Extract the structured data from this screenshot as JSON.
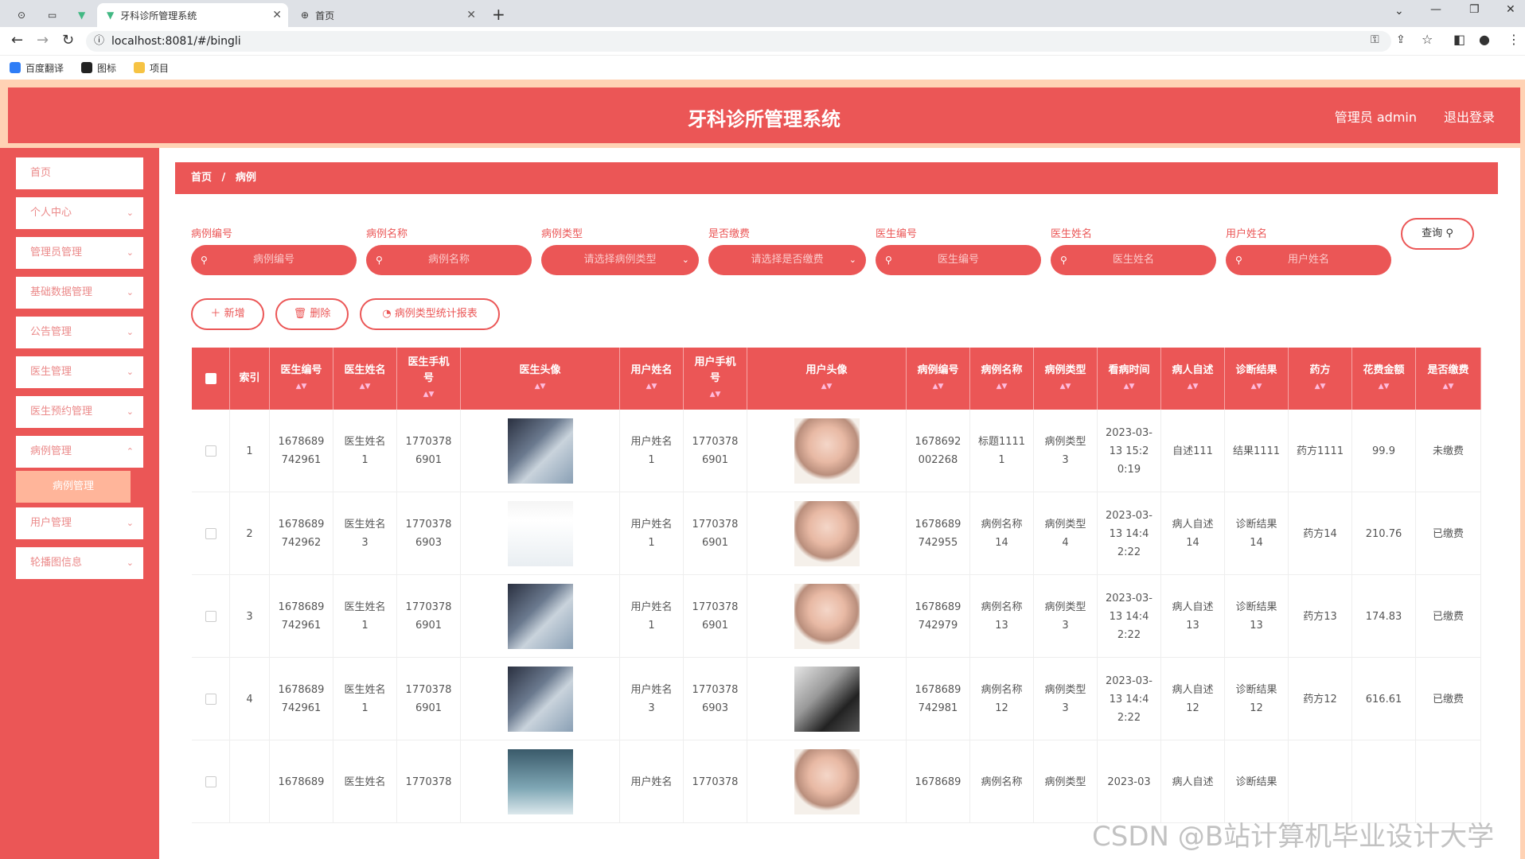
{
  "browser": {
    "tabs": [
      {
        "label": "牙科诊所管理系统"
      },
      {
        "label": "首页"
      }
    ],
    "url": "localhost:8081/#/bingli",
    "bookmarks": [
      "百度翻译",
      "图标",
      "项目"
    ]
  },
  "header": {
    "title": "牙科诊所管理系统",
    "user": "管理员 admin",
    "logout": "退出登录"
  },
  "sidebar": {
    "items": [
      {
        "label": "首页"
      },
      {
        "label": "个人中心"
      },
      {
        "label": "管理员管理"
      },
      {
        "label": "基础数据管理"
      },
      {
        "label": "公告管理"
      },
      {
        "label": "医生管理"
      },
      {
        "label": "医生预约管理"
      },
      {
        "label": "病例管理"
      },
      {
        "label": "用户管理"
      },
      {
        "label": "轮播图信息"
      }
    ],
    "active_sub": "病例管理"
  },
  "breadcrumb": {
    "home": "首页",
    "sep": "/",
    "current": "病例"
  },
  "filters": [
    {
      "label": "病例编号",
      "placeholder": "病例编号"
    },
    {
      "label": "病例名称",
      "placeholder": "病例名称"
    },
    {
      "label": "病例类型",
      "placeholder": "请选择病例类型"
    },
    {
      "label": "是否缴费",
      "placeholder": "请选择是否缴费"
    },
    {
      "label": "医生编号",
      "placeholder": "医生编号"
    },
    {
      "label": "医生姓名",
      "placeholder": "医生姓名"
    },
    {
      "label": "用户姓名",
      "placeholder": "用户姓名"
    }
  ],
  "buttons": {
    "query": "查询",
    "add": "新增",
    "delete": "删除",
    "report": "病例类型统计报表"
  },
  "table": {
    "headers": [
      "索引",
      "医生编号",
      "医生姓名",
      "医生手机号",
      "医生头像",
      "用户姓名",
      "用户手机号",
      "用户头像",
      "病例编号",
      "病例名称",
      "病例类型",
      "看病时间",
      "病人自述",
      "诊断结果",
      "药方",
      "花费金额",
      "是否缴费"
    ],
    "rows": [
      {
        "index": "1",
        "doc_no": "1678689742961",
        "doc_name": "医生姓名1",
        "doc_phone": "17703786901",
        "user_name": "用户姓名1",
        "user_phone": "17703786901",
        "case_no": "1678692002268",
        "case_name": "标题11111",
        "case_type": "病例类型3",
        "time": "2023-03-13 15:20:19",
        "complaint": "自述111",
        "diagnosis": "结果1111",
        "rx": "药方1111",
        "cost": "99.9",
        "paid": "未缴费"
      },
      {
        "index": "2",
        "doc_no": "1678689742962",
        "doc_name": "医生姓名3",
        "doc_phone": "17703786903",
        "user_name": "用户姓名1",
        "user_phone": "17703786901",
        "case_no": "1678689742955",
        "case_name": "病例名称14",
        "case_type": "病例类型4",
        "time": "2023-03-13 14:42:22",
        "complaint": "病人自述14",
        "diagnosis": "诊断结果14",
        "rx": "药方14",
        "cost": "210.76",
        "paid": "已缴费"
      },
      {
        "index": "3",
        "doc_no": "1678689742961",
        "doc_name": "医生姓名1",
        "doc_phone": "17703786901",
        "user_name": "用户姓名1",
        "user_phone": "17703786901",
        "case_no": "1678689742979",
        "case_name": "病例名称13",
        "case_type": "病例类型3",
        "time": "2023-03-13 14:42:22",
        "complaint": "病人自述13",
        "diagnosis": "诊断结果13",
        "rx": "药方13",
        "cost": "174.83",
        "paid": "已缴费"
      },
      {
        "index": "4",
        "doc_no": "1678689742961",
        "doc_name": "医生姓名1",
        "doc_phone": "17703786901",
        "user_name": "用户姓名3",
        "user_phone": "17703786903",
        "case_no": "1678689742981",
        "case_name": "病例名称12",
        "case_type": "病例类型3",
        "time": "2023-03-13 14:42:22",
        "complaint": "病人自述12",
        "diagnosis": "诊断结果12",
        "rx": "药方12",
        "cost": "616.61",
        "paid": "已缴费"
      },
      {
        "index": "",
        "doc_no": "1678689",
        "doc_name": "医生姓名",
        "doc_phone": "1770378",
        "user_name": "用户姓名",
        "user_phone": "1770378",
        "case_no": "1678689",
        "case_name": "病例名称",
        "case_type": "病例类型",
        "time": "2023-03",
        "complaint": "病人自述",
        "diagnosis": "诊断结果",
        "rx": "",
        "cost": "",
        "paid": ""
      }
    ]
  },
  "watermark": "CSDN @B站计算机毕业设计大学",
  "colors": {
    "primary": "#eb5656",
    "accent": "#ffb59a"
  }
}
